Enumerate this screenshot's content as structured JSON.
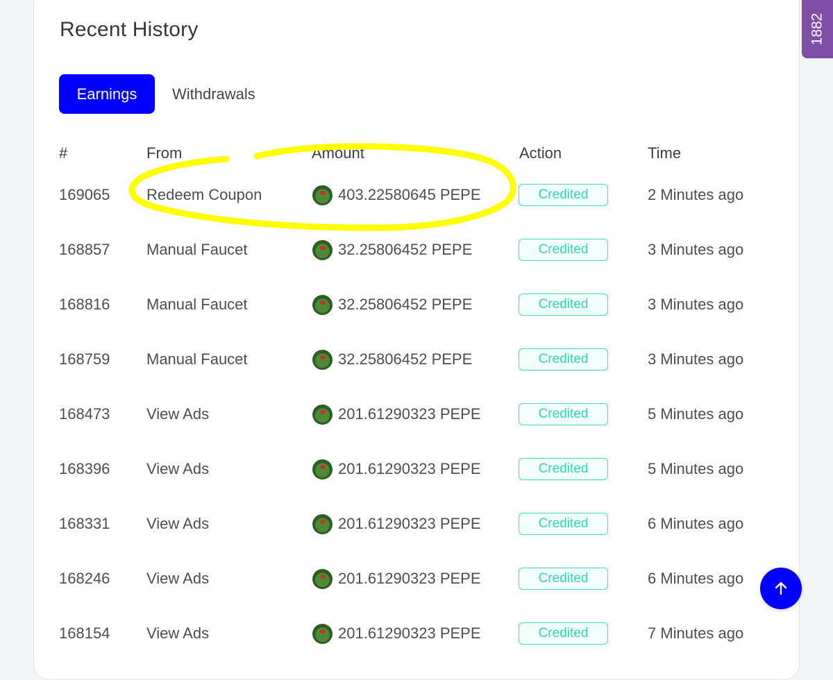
{
  "card": {
    "title": "Recent History"
  },
  "tabs": [
    {
      "label": "Earnings",
      "active": true
    },
    {
      "label": "Withdrawals",
      "active": false
    }
  ],
  "table": {
    "headers": [
      "#",
      "From",
      "Amount",
      "Action",
      "Time"
    ],
    "rows": [
      {
        "id": "169065",
        "from": "Redeem Coupon",
        "amount": "403.22580645 PEPE",
        "action": "Credited",
        "time": "2 Minutes ago"
      },
      {
        "id": "168857",
        "from": "Manual Faucet",
        "amount": "32.25806452 PEPE",
        "action": "Credited",
        "time": "3 Minutes ago"
      },
      {
        "id": "168816",
        "from": "Manual Faucet",
        "amount": "32.25806452 PEPE",
        "action": "Credited",
        "time": "3 Minutes ago"
      },
      {
        "id": "168759",
        "from": "Manual Faucet",
        "amount": "32.25806452 PEPE",
        "action": "Credited",
        "time": "3 Minutes ago"
      },
      {
        "id": "168473",
        "from": "View Ads",
        "amount": "201.61290323 PEPE",
        "action": "Credited",
        "time": "5 Minutes ago"
      },
      {
        "id": "168396",
        "from": "View Ads",
        "amount": "201.61290323 PEPE",
        "action": "Credited",
        "time": "5 Minutes ago"
      },
      {
        "id": "168331",
        "from": "View Ads",
        "amount": "201.61290323 PEPE",
        "action": "Credited",
        "time": "6 Minutes ago"
      },
      {
        "id": "168246",
        "from": "View Ads",
        "amount": "201.61290323 PEPE",
        "action": "Credited",
        "time": "6 Minutes ago"
      },
      {
        "id": "168154",
        "from": "View Ads",
        "amount": "201.61290323 PEPE",
        "action": "Credited",
        "time": "7 Minutes ago"
      }
    ]
  },
  "side_tab": {
    "label": "1882"
  },
  "icons": {
    "coin": "pepe-coin-icon",
    "scroll_top": "arrow-up-icon"
  },
  "colors": {
    "primary": "#0000ff",
    "badge_text": "#2fd6b8",
    "badge_border": "#3fd9c0",
    "side_tab": "#7f4fa8",
    "highlight_annotation": "#ffff00"
  }
}
